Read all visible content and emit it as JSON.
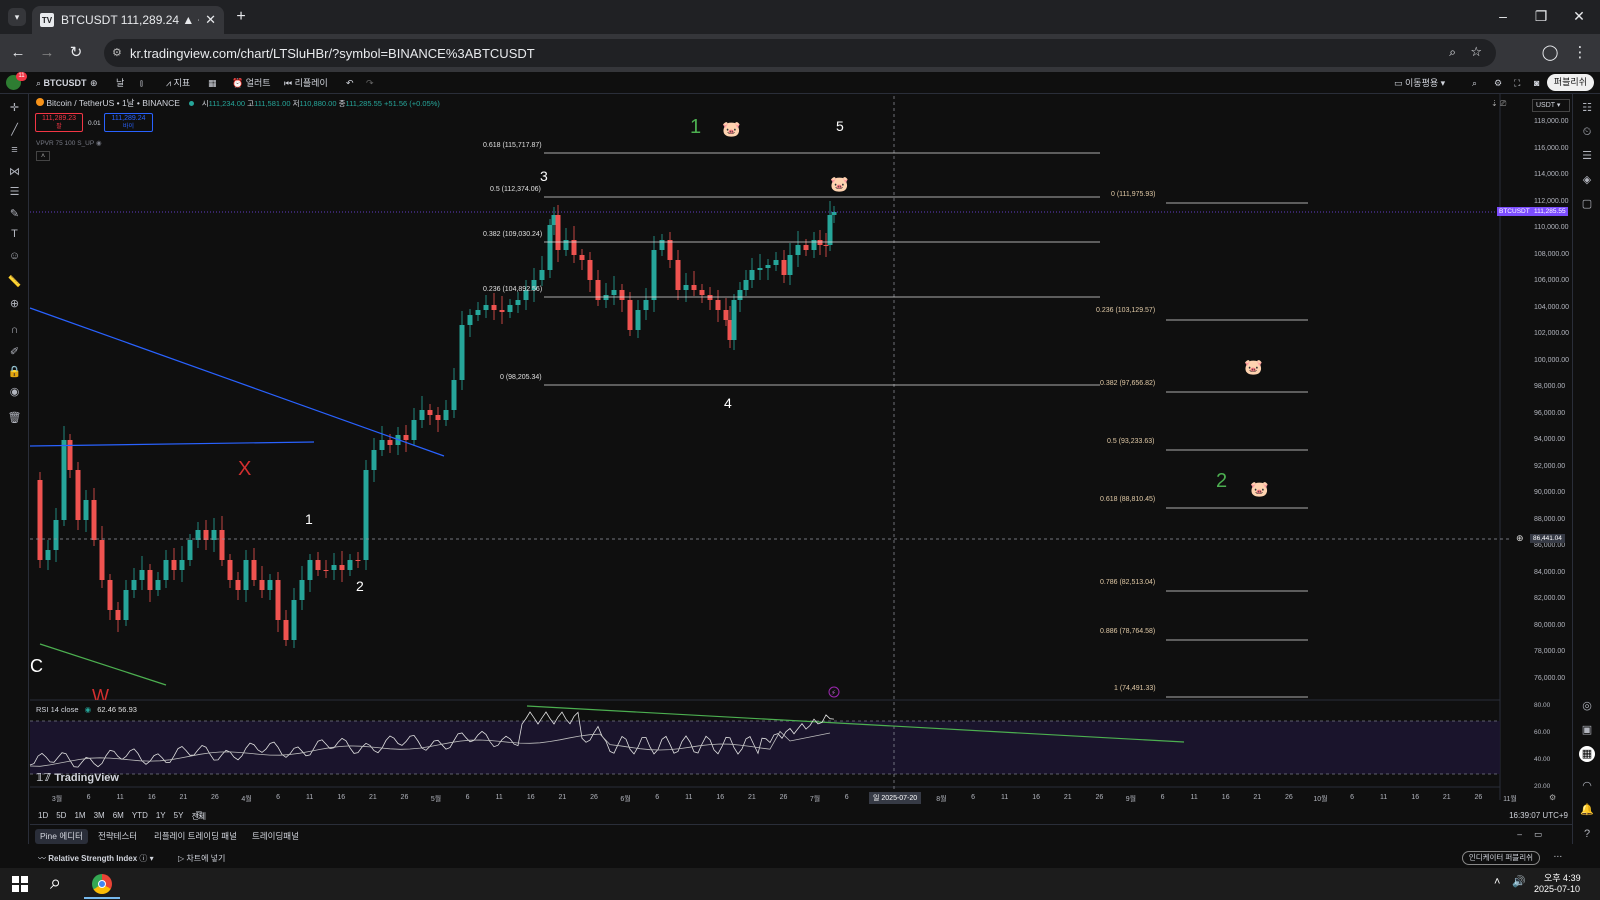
{
  "browser": {
    "tab_title": "BTCUSDT 111,289.24 ▲ +0.05",
    "tab_favicon": "TV",
    "url": "kr.tradingview.com/chart/LTSluHBr/?symbol=BINANCE%3ABTCUSDT"
  },
  "toolbar": {
    "avatar_badge": "11",
    "symbol": "BTCUSDT",
    "interval": "날",
    "indicators": "지표",
    "alert": "얼러트",
    "replay": "리플레이",
    "layout_name": "이동평용",
    "publish": "퍼블리쉬"
  },
  "legend": {
    "title": "Bitcoin / TetherUS • 1날 • BINANCE",
    "o_label": "시",
    "o": "111,234.00",
    "h_label": "고",
    "h": "111,581.00",
    "l_label": "저",
    "l": "110,880.00",
    "c_label": "종",
    "c": "111,285.55",
    "change": "+51.56 (+0.05%)",
    "sell_price": "111,289.23",
    "sell_label": "팔",
    "spread": "0.01",
    "buy_price": "111,289.24",
    "buy_label": "바이",
    "vpvr": "VPVR 75 100 S_UP"
  },
  "price_axis": {
    "currency": "USDT",
    "labels": [
      "118,000.00",
      "116,000.00",
      "114,000.00",
      "112,000.00",
      "110,000.00",
      "108,000.00",
      "106,000.00",
      "104,000.00",
      "102,000.00",
      "100,000.00",
      "98,000.00",
      "96,000.00",
      "94,000.00",
      "92,000.00",
      "90,000.00",
      "88,000.00",
      "86,000.00",
      "84,000.00",
      "82,000.00",
      "80,000.00",
      "78,000.00",
      "76,000.00"
    ],
    "symbol_tag": "BTCUSDT",
    "current_price": "111,285.55",
    "crosshair_price": "86,441.04"
  },
  "fib_left": [
    {
      "label": "0.618 (115,717.87)"
    },
    {
      "label": "0.5 (112,374.06)"
    },
    {
      "label": "0.382 (109,030.24)"
    },
    {
      "label": "0.236 (104,892.56)"
    },
    {
      "label": "0 (98,205.34)"
    }
  ],
  "fib_right": [
    {
      "label": "0 (111,975.93)"
    },
    {
      "label": "0.236 (103,129.57)"
    },
    {
      "label": "0.382 (97,656.82)"
    },
    {
      "label": "0.5 (93,233.63)"
    },
    {
      "label": "0.618 (88,810.45)"
    },
    {
      "label": "0.786 (82,513.04)"
    },
    {
      "label": "0.886 (78,764.58)"
    },
    {
      "label": "1 (74,491.33)"
    }
  ],
  "wave_labels": {
    "green_1": "1",
    "white_5": "5",
    "white_3": "3",
    "white_4": "4",
    "white_1": "1",
    "white_2": "2",
    "red_x": "X",
    "green_2": "2",
    "c": "C",
    "w": "W"
  },
  "rsi": {
    "name": "RSI 14 close",
    "v1": "62.46",
    "v2": "56.93",
    "axis": [
      "80.00",
      "60.00",
      "40.00",
      "20.00"
    ]
  },
  "time_axis": {
    "labels": [
      "3월",
      "6",
      "11",
      "16",
      "21",
      "26",
      "4월",
      "6",
      "11",
      "16",
      "21",
      "26",
      "5월",
      "6",
      "11",
      "16",
      "21",
      "26",
      "6월",
      "6",
      "11",
      "16",
      "21",
      "26",
      "7월",
      "6",
      "11",
      "26",
      "8월",
      "6",
      "11",
      "16",
      "21",
      "26",
      "9월",
      "6",
      "11",
      "16",
      "21",
      "26",
      "10월",
      "6",
      "11",
      "16",
      "21",
      "26",
      "11월"
    ],
    "crosshair_date": "일 2025-07-20"
  },
  "watermark": "TradingView",
  "timeframes": [
    "1D",
    "5D",
    "1M",
    "3M",
    "6M",
    "YTD",
    "1Y",
    "5Y",
    "전체"
  ],
  "clock": "16:39:07 UTC+9",
  "bottom_tabs": [
    "Pine 에디터",
    "전략테스터",
    "리플레이 트레이딩 패널",
    "트레이딩패널"
  ],
  "bottom_row": {
    "indicator": "Relative Strength Index",
    "add_to_chart": "차트에 넣기",
    "publish_indicator": "인디케이터 퍼블리쉬"
  },
  "taskbar": {
    "time": "오후 4:39",
    "date": "2025-07-10"
  },
  "colors": {
    "up": "#26a69a",
    "down": "#ef5350",
    "fib_text": "#e0c9a6",
    "green_label": "#4caf50"
  }
}
